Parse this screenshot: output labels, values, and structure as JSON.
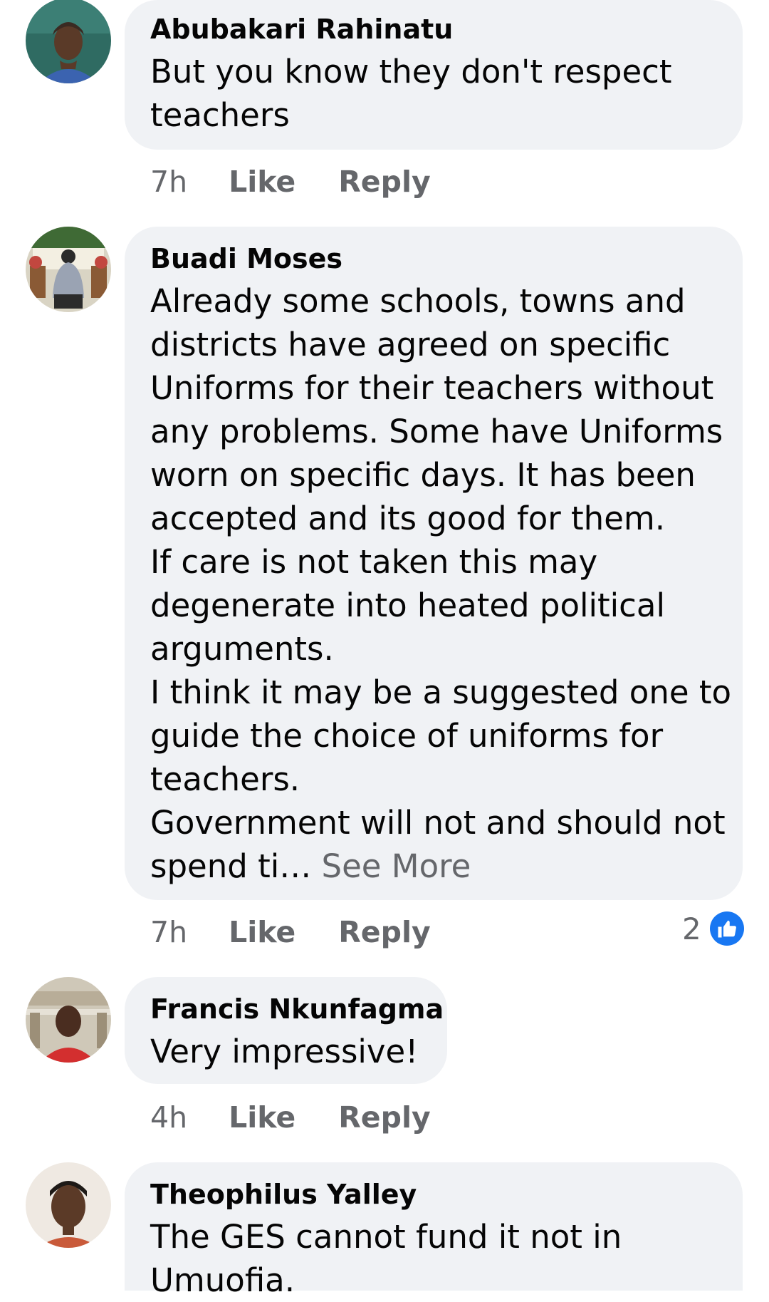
{
  "comments": [
    {
      "author": "Abubakari Rahinatu",
      "lines": [
        "But you know they don't respect",
        "teachers"
      ],
      "time": "7h",
      "like_label": "Like",
      "reply_label": "Reply"
    },
    {
      "author": "Buadi Moses",
      "lines": [
        "Already some schools, towns and",
        "districts have agreed on specific",
        "Uniforms for their teachers without",
        "any problems. Some have Uniforms",
        "worn on specific days. It has been",
        "accepted and its good for them.",
        "If care is not taken this may",
        "degenerate into heated political",
        "arguments.",
        "I think it may be a suggested one to",
        "guide the choice of uniforms for",
        "teachers.",
        "Government will not and should not",
        "spend ti…"
      ],
      "see_more": "See More",
      "time": "7h",
      "like_label": "Like",
      "reply_label": "Reply",
      "reaction_count": "2",
      "reaction_icon": "thumbs-up-icon"
    },
    {
      "author": "Francis Nkunfagma",
      "lines": [
        "Very impressive!"
      ],
      "time": "4h",
      "like_label": "Like",
      "reply_label": "Reply"
    },
    {
      "author": "Theophilus Yalley",
      "lines": [
        "The GES cannot fund it not in",
        "Umuofia."
      ]
    }
  ],
  "colors": {
    "bubble_bg": "#f0f2f5",
    "text": "#050505",
    "secondary_text": "#65676b",
    "like_blue": "#1877f2"
  }
}
